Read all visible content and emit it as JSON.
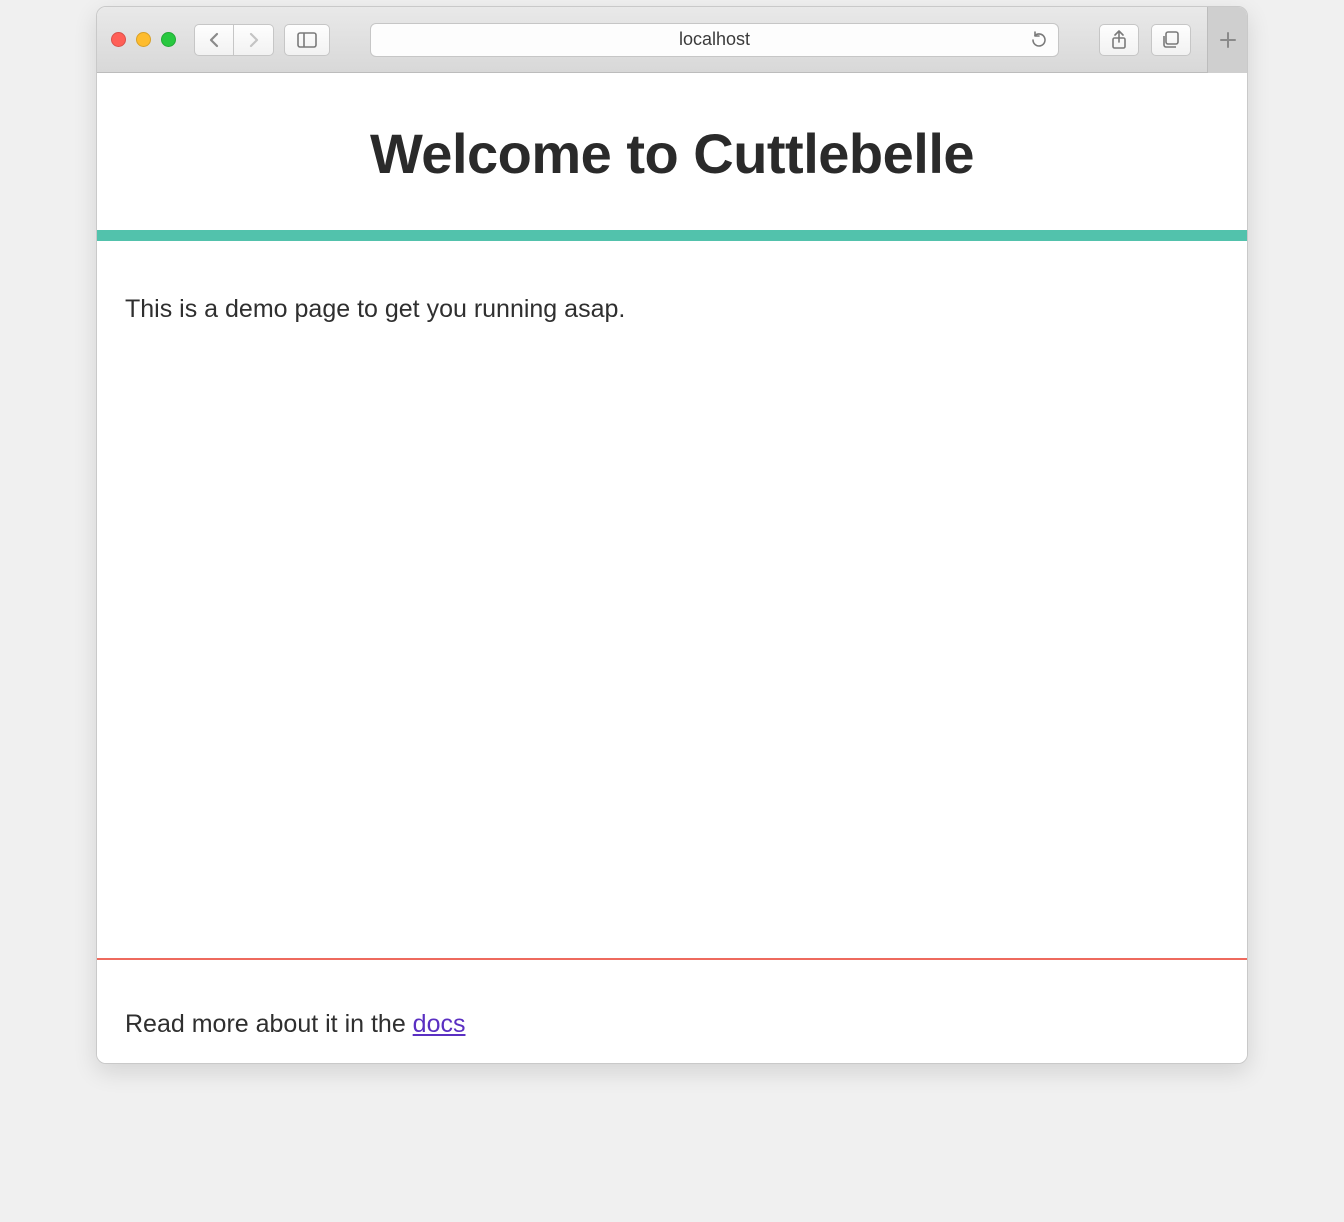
{
  "browser": {
    "address": "localhost"
  },
  "page": {
    "title": "Welcome to Cuttlebelle",
    "intro": "This is a demo page to get you running asap.",
    "footer_prefix": "Read more about it in the ",
    "footer_link_text": "docs"
  },
  "colors": {
    "teal": "#52c2ac",
    "coral": "#ee6a5e",
    "link": "#5a2fc2"
  }
}
